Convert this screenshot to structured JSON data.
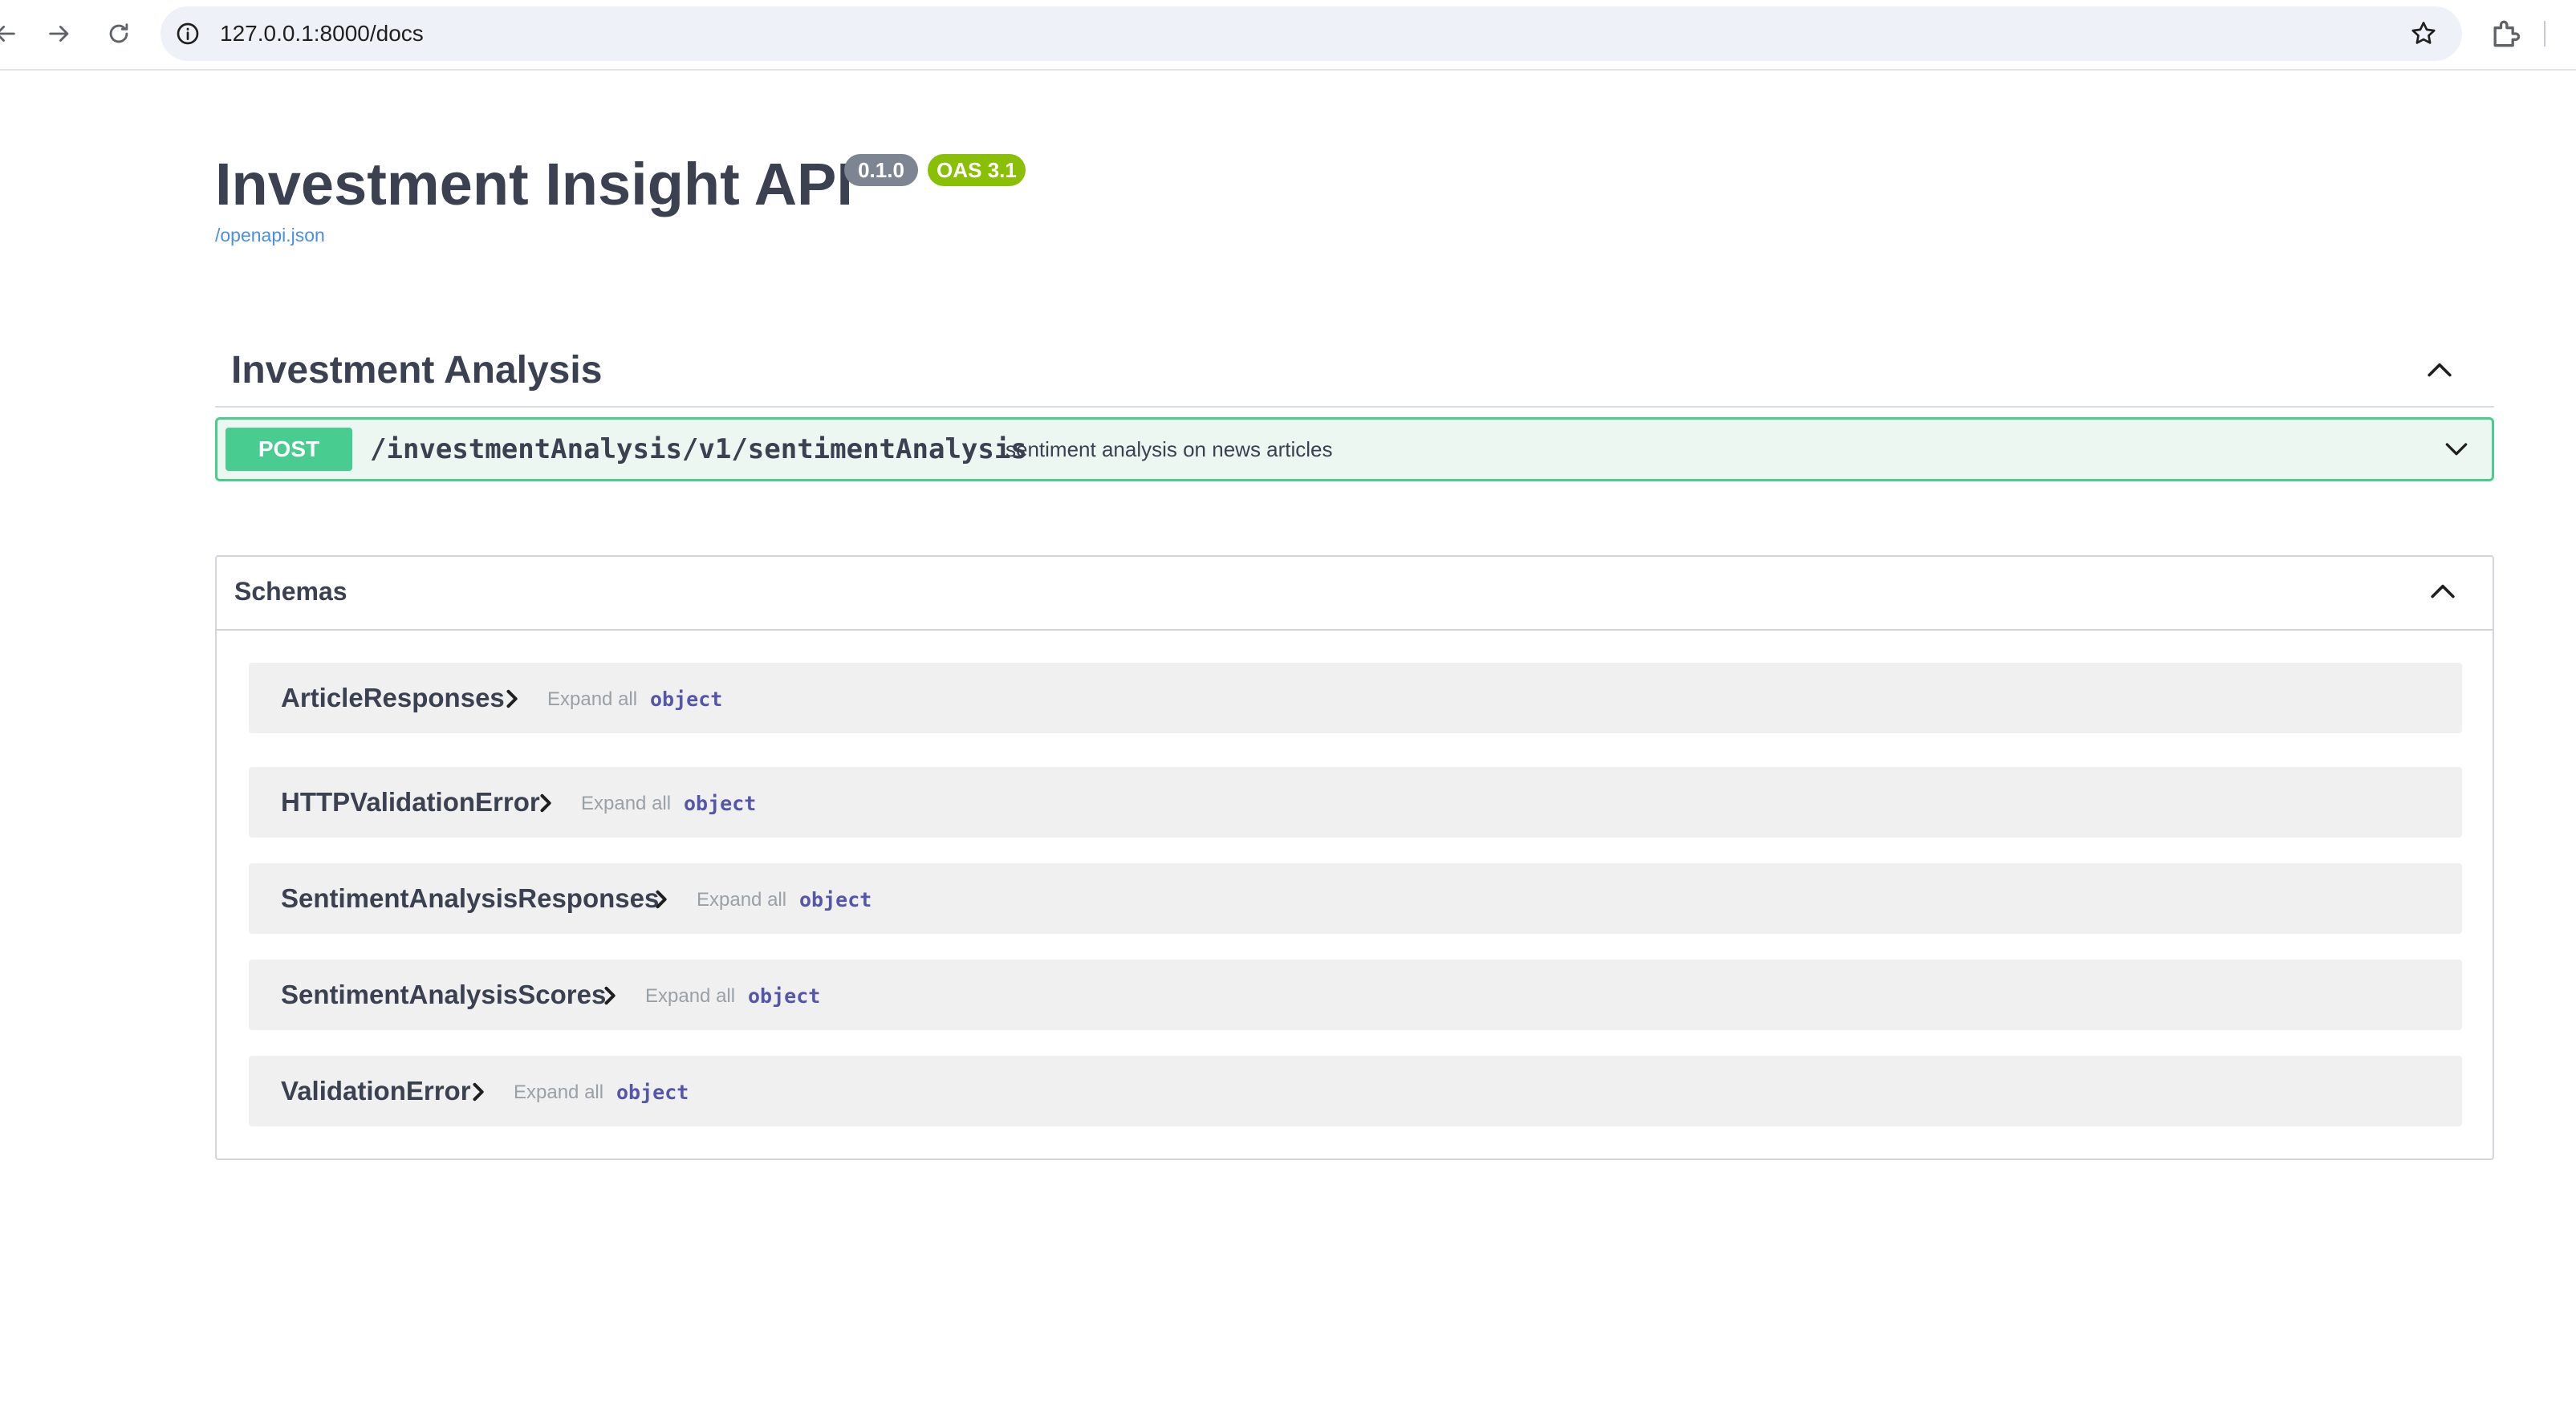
{
  "browser": {
    "url": "127.0.0.1:8000/docs",
    "icons": [
      "back-icon",
      "forward-icon",
      "reload-icon",
      "info-icon",
      "star-icon",
      "extensions-icon"
    ]
  },
  "info": {
    "title": "Investment Insight API",
    "version": "0.1.0",
    "oas": "OAS 3.1",
    "spec_link": "/openapi.json"
  },
  "tag": {
    "name": "Investment Analysis",
    "operations": [
      {
        "method": "POST",
        "path": "/investmentAnalysis/v1/sentimentAnalysis",
        "summary": "sentiment analysis on news articles"
      }
    ]
  },
  "schemas": {
    "title": "Schemas",
    "items": [
      {
        "name": "ArticleResponses",
        "expand": "Expand all",
        "type": "object"
      },
      {
        "name": "HTTPValidationError",
        "expand": "Expand all",
        "type": "object"
      },
      {
        "name": "SentimentAnalysisResponses",
        "expand": "Expand all",
        "type": "object"
      },
      {
        "name": "SentimentAnalysisScores",
        "expand": "Expand all",
        "type": "object"
      },
      {
        "name": "ValidationError",
        "expand": "Expand all",
        "type": "object"
      }
    ]
  },
  "colors": {
    "post": "#49cc90",
    "post_bg": "#ecf7f2",
    "badge_version": "#7d8492",
    "badge_oas": "#89bf04",
    "link": "#4990e2",
    "type": "#55a"
  }
}
